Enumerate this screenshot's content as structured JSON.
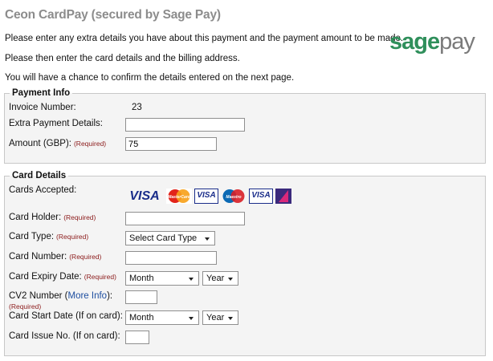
{
  "header": {
    "title": "Ceon CardPay (secured by Sage Pay)",
    "intro_lines": [
      "Please enter any extra details you have about this payment and the payment amount to be made.",
      "Please then enter the card details and the billing address.",
      "You will have a chance to confirm the details entered on the next page."
    ],
    "logo": {
      "sage": "sage",
      "pay": "pay"
    }
  },
  "payment_info": {
    "legend": "Payment Info",
    "invoice_label": "Invoice Number:",
    "invoice_value": "23",
    "extra_label": "Extra Payment Details:",
    "extra_value": "",
    "amount_label": "Amount (GBP):",
    "amount_required": "(Required)",
    "amount_value": "75"
  },
  "card_details": {
    "legend": "Card Details",
    "cards_label": "Cards Accepted:",
    "cards": [
      "VISA",
      "MasterCard",
      "VISA",
      "Maestro",
      "VISA",
      "Delta"
    ],
    "holder_label": "Card Holder:",
    "type_label": "Card Type:",
    "type_value": "Select Card Type",
    "number_label": "Card Number:",
    "expiry_label": "Card Expiry Date:",
    "expiry_month": "Month",
    "expiry_year": "Year",
    "cv2_label": "CV2 Number (",
    "cv2_link": "More Info",
    "cv2_label_end": "):",
    "start_label": "Card Start Date (If on card):",
    "start_month": "Month",
    "start_year": "Year",
    "issue_label": "Card Issue No. (If on card):",
    "required": "(Required)"
  },
  "colors": {
    "title": "#8c8c8c",
    "required": "#8b1a1a",
    "link": "#1f4fa0",
    "sage_green": "#2f8f5b",
    "panel_bg": "#f4f4f4"
  }
}
